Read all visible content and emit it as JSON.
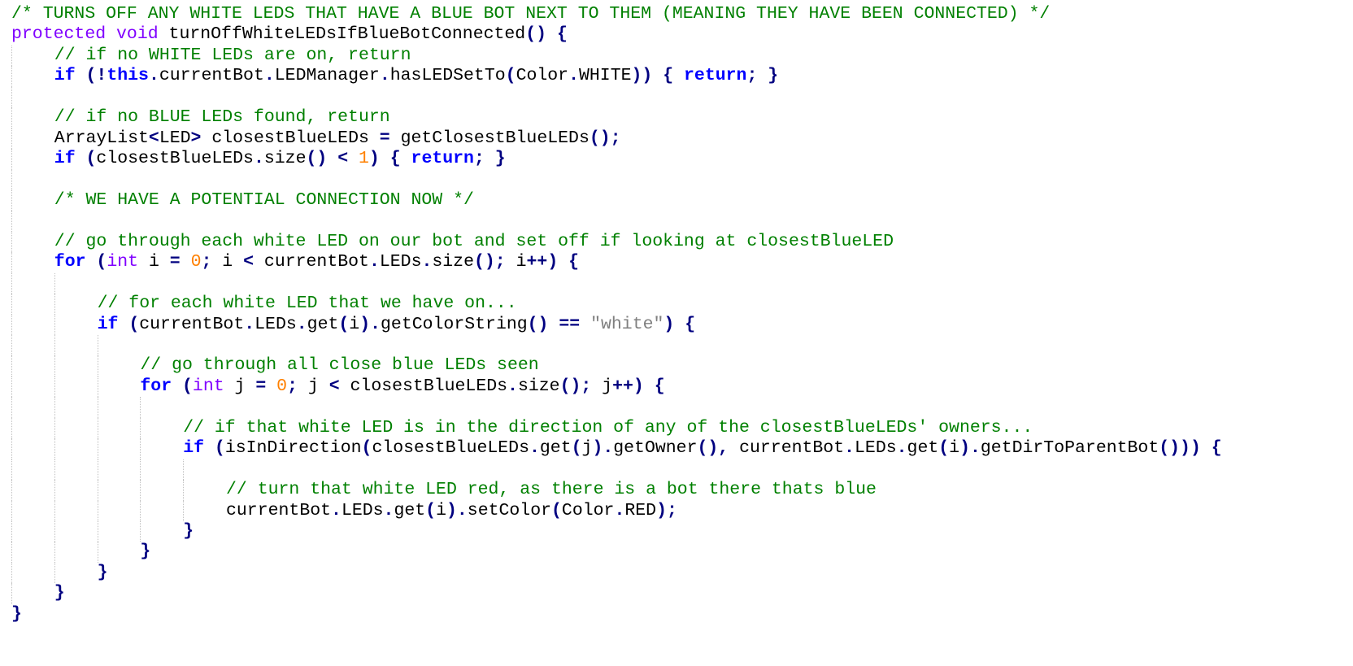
{
  "editor": {
    "colors": {
      "background": "#ffffff",
      "comment": "#008000",
      "keyword": "#0000ff",
      "type": "#8000ff",
      "number": "#ff8000",
      "string": "#808080",
      "operator": "#000080",
      "plain": "#000000",
      "indent_guide": "#c0c0c0"
    },
    "lines": [
      {
        "indent": 0,
        "tokens": [
          {
            "t": "comment",
            "v": "/* TURNS OFF ANY WHITE LEDS THAT HAVE A BLUE BOT NEXT TO THEM (MEANING THEY HAVE BEEN CONNECTED) */"
          }
        ]
      },
      {
        "indent": 0,
        "tokens": [
          {
            "t": "type",
            "v": "protected"
          },
          {
            "t": "plain",
            "v": " "
          },
          {
            "t": "type",
            "v": "void"
          },
          {
            "t": "plain",
            "v": " turnOffWhiteLEDsIfBlueBotConnected"
          },
          {
            "t": "operator",
            "v": "()"
          },
          {
            "t": "plain",
            "v": " "
          },
          {
            "t": "operator",
            "v": "{"
          }
        ]
      },
      {
        "indent": 1,
        "tokens": [
          {
            "t": "comment",
            "v": "// if no WHITE LEDs are on, return"
          }
        ]
      },
      {
        "indent": 1,
        "tokens": [
          {
            "t": "keyword",
            "v": "if"
          },
          {
            "t": "plain",
            "v": " "
          },
          {
            "t": "operator",
            "v": "(!"
          },
          {
            "t": "keyword",
            "v": "this"
          },
          {
            "t": "operator",
            "v": "."
          },
          {
            "t": "plain",
            "v": "currentBot"
          },
          {
            "t": "operator",
            "v": "."
          },
          {
            "t": "plain",
            "v": "LEDManager"
          },
          {
            "t": "operator",
            "v": "."
          },
          {
            "t": "plain",
            "v": "hasLEDSetTo"
          },
          {
            "t": "operator",
            "v": "("
          },
          {
            "t": "plain",
            "v": "Color"
          },
          {
            "t": "operator",
            "v": "."
          },
          {
            "t": "plain",
            "v": "WHITE"
          },
          {
            "t": "operator",
            "v": "))"
          },
          {
            "t": "plain",
            "v": " "
          },
          {
            "t": "operator",
            "v": "{"
          },
          {
            "t": "plain",
            "v": " "
          },
          {
            "t": "keyword",
            "v": "return"
          },
          {
            "t": "operator",
            "v": ";"
          },
          {
            "t": "plain",
            "v": " "
          },
          {
            "t": "operator",
            "v": "}"
          }
        ]
      },
      {
        "indent": 1,
        "tokens": []
      },
      {
        "indent": 1,
        "tokens": [
          {
            "t": "comment",
            "v": "// if no BLUE LEDs found, return"
          }
        ]
      },
      {
        "indent": 1,
        "tokens": [
          {
            "t": "plain",
            "v": "ArrayList"
          },
          {
            "t": "operator",
            "v": "<"
          },
          {
            "t": "plain",
            "v": "LED"
          },
          {
            "t": "operator",
            "v": ">"
          },
          {
            "t": "plain",
            "v": " closestBlueLEDs "
          },
          {
            "t": "operator",
            "v": "="
          },
          {
            "t": "plain",
            "v": " getClosestBlueLEDs"
          },
          {
            "t": "operator",
            "v": "();"
          }
        ]
      },
      {
        "indent": 1,
        "tokens": [
          {
            "t": "keyword",
            "v": "if"
          },
          {
            "t": "plain",
            "v": " "
          },
          {
            "t": "operator",
            "v": "("
          },
          {
            "t": "plain",
            "v": "closestBlueLEDs"
          },
          {
            "t": "operator",
            "v": "."
          },
          {
            "t": "plain",
            "v": "size"
          },
          {
            "t": "operator",
            "v": "()"
          },
          {
            "t": "plain",
            "v": " "
          },
          {
            "t": "operator",
            "v": "<"
          },
          {
            "t": "plain",
            "v": " "
          },
          {
            "t": "number",
            "v": "1"
          },
          {
            "t": "operator",
            "v": ")"
          },
          {
            "t": "plain",
            "v": " "
          },
          {
            "t": "operator",
            "v": "{"
          },
          {
            "t": "plain",
            "v": " "
          },
          {
            "t": "keyword",
            "v": "return"
          },
          {
            "t": "operator",
            "v": ";"
          },
          {
            "t": "plain",
            "v": " "
          },
          {
            "t": "operator",
            "v": "}"
          }
        ]
      },
      {
        "indent": 1,
        "tokens": []
      },
      {
        "indent": 1,
        "tokens": [
          {
            "t": "comment",
            "v": "/* WE HAVE A POTENTIAL CONNECTION NOW */"
          }
        ]
      },
      {
        "indent": 1,
        "tokens": []
      },
      {
        "indent": 1,
        "tokens": [
          {
            "t": "comment",
            "v": "// go through each white LED on our bot and set off if looking at closestBlueLED"
          }
        ]
      },
      {
        "indent": 1,
        "tokens": [
          {
            "t": "keyword",
            "v": "for"
          },
          {
            "t": "plain",
            "v": " "
          },
          {
            "t": "operator",
            "v": "("
          },
          {
            "t": "type",
            "v": "int"
          },
          {
            "t": "plain",
            "v": " i "
          },
          {
            "t": "operator",
            "v": "="
          },
          {
            "t": "plain",
            "v": " "
          },
          {
            "t": "number",
            "v": "0"
          },
          {
            "t": "operator",
            "v": ";"
          },
          {
            "t": "plain",
            "v": " i "
          },
          {
            "t": "operator",
            "v": "<"
          },
          {
            "t": "plain",
            "v": " currentBot"
          },
          {
            "t": "operator",
            "v": "."
          },
          {
            "t": "plain",
            "v": "LEDs"
          },
          {
            "t": "operator",
            "v": "."
          },
          {
            "t": "plain",
            "v": "size"
          },
          {
            "t": "operator",
            "v": "();"
          },
          {
            "t": "plain",
            "v": " i"
          },
          {
            "t": "operator",
            "v": "++)"
          },
          {
            "t": "plain",
            "v": " "
          },
          {
            "t": "operator",
            "v": "{"
          }
        ]
      },
      {
        "indent": 2,
        "tokens": []
      },
      {
        "indent": 2,
        "tokens": [
          {
            "t": "comment",
            "v": "// for each white LED that we have on..."
          }
        ]
      },
      {
        "indent": 2,
        "tokens": [
          {
            "t": "keyword",
            "v": "if"
          },
          {
            "t": "plain",
            "v": " "
          },
          {
            "t": "operator",
            "v": "("
          },
          {
            "t": "plain",
            "v": "currentBot"
          },
          {
            "t": "operator",
            "v": "."
          },
          {
            "t": "plain",
            "v": "LEDs"
          },
          {
            "t": "operator",
            "v": "."
          },
          {
            "t": "plain",
            "v": "get"
          },
          {
            "t": "operator",
            "v": "("
          },
          {
            "t": "plain",
            "v": "i"
          },
          {
            "t": "operator",
            "v": ")."
          },
          {
            "t": "plain",
            "v": "getColorString"
          },
          {
            "t": "operator",
            "v": "()"
          },
          {
            "t": "plain",
            "v": " "
          },
          {
            "t": "operator",
            "v": "=="
          },
          {
            "t": "plain",
            "v": " "
          },
          {
            "t": "string",
            "v": "\"white\""
          },
          {
            "t": "operator",
            "v": ")"
          },
          {
            "t": "plain",
            "v": " "
          },
          {
            "t": "operator",
            "v": "{"
          }
        ]
      },
      {
        "indent": 3,
        "tokens": []
      },
      {
        "indent": 3,
        "tokens": [
          {
            "t": "comment",
            "v": "// go through all close blue LEDs seen"
          }
        ]
      },
      {
        "indent": 3,
        "tokens": [
          {
            "t": "keyword",
            "v": "for"
          },
          {
            "t": "plain",
            "v": " "
          },
          {
            "t": "operator",
            "v": "("
          },
          {
            "t": "type",
            "v": "int"
          },
          {
            "t": "plain",
            "v": " j "
          },
          {
            "t": "operator",
            "v": "="
          },
          {
            "t": "plain",
            "v": " "
          },
          {
            "t": "number",
            "v": "0"
          },
          {
            "t": "operator",
            "v": ";"
          },
          {
            "t": "plain",
            "v": " j "
          },
          {
            "t": "operator",
            "v": "<"
          },
          {
            "t": "plain",
            "v": " closestBlueLEDs"
          },
          {
            "t": "operator",
            "v": "."
          },
          {
            "t": "plain",
            "v": "size"
          },
          {
            "t": "operator",
            "v": "();"
          },
          {
            "t": "plain",
            "v": " j"
          },
          {
            "t": "operator",
            "v": "++)"
          },
          {
            "t": "plain",
            "v": " "
          },
          {
            "t": "operator",
            "v": "{"
          }
        ]
      },
      {
        "indent": 4,
        "tokens": []
      },
      {
        "indent": 4,
        "tokens": [
          {
            "t": "comment",
            "v": "// if that white LED is in the direction of any of the closestBlueLEDs' owners..."
          }
        ]
      },
      {
        "indent": 4,
        "tokens": [
          {
            "t": "keyword",
            "v": "if"
          },
          {
            "t": "plain",
            "v": " "
          },
          {
            "t": "operator",
            "v": "("
          },
          {
            "t": "plain",
            "v": "isInDirection"
          },
          {
            "t": "operator",
            "v": "("
          },
          {
            "t": "plain",
            "v": "closestBlueLEDs"
          },
          {
            "t": "operator",
            "v": "."
          },
          {
            "t": "plain",
            "v": "get"
          },
          {
            "t": "operator",
            "v": "("
          },
          {
            "t": "plain",
            "v": "j"
          },
          {
            "t": "operator",
            "v": ")."
          },
          {
            "t": "plain",
            "v": "getOwner"
          },
          {
            "t": "operator",
            "v": "(),"
          },
          {
            "t": "plain",
            "v": " currentBot"
          },
          {
            "t": "operator",
            "v": "."
          },
          {
            "t": "plain",
            "v": "LEDs"
          },
          {
            "t": "operator",
            "v": "."
          },
          {
            "t": "plain",
            "v": "get"
          },
          {
            "t": "operator",
            "v": "("
          },
          {
            "t": "plain",
            "v": "i"
          },
          {
            "t": "operator",
            "v": ")."
          },
          {
            "t": "plain",
            "v": "getDirToParentBot"
          },
          {
            "t": "operator",
            "v": "()))"
          },
          {
            "t": "plain",
            "v": " "
          },
          {
            "t": "operator",
            "v": "{"
          }
        ]
      },
      {
        "indent": 5,
        "tokens": []
      },
      {
        "indent": 5,
        "tokens": [
          {
            "t": "comment",
            "v": "// turn that white LED red, as there is a bot there thats blue"
          }
        ]
      },
      {
        "indent": 5,
        "tokens": [
          {
            "t": "plain",
            "v": "currentBot"
          },
          {
            "t": "operator",
            "v": "."
          },
          {
            "t": "plain",
            "v": "LEDs"
          },
          {
            "t": "operator",
            "v": "."
          },
          {
            "t": "plain",
            "v": "get"
          },
          {
            "t": "operator",
            "v": "("
          },
          {
            "t": "plain",
            "v": "i"
          },
          {
            "t": "operator",
            "v": ")."
          },
          {
            "t": "plain",
            "v": "setColor"
          },
          {
            "t": "operator",
            "v": "("
          },
          {
            "t": "plain",
            "v": "Color"
          },
          {
            "t": "operator",
            "v": "."
          },
          {
            "t": "plain",
            "v": "RED"
          },
          {
            "t": "operator",
            "v": ");"
          }
        ]
      },
      {
        "indent": 4,
        "tokens": [
          {
            "t": "operator",
            "v": "}"
          }
        ]
      },
      {
        "indent": 3,
        "tokens": [
          {
            "t": "operator",
            "v": "}"
          }
        ]
      },
      {
        "indent": 2,
        "tokens": [
          {
            "t": "operator",
            "v": "}"
          }
        ]
      },
      {
        "indent": 1,
        "tokens": [
          {
            "t": "operator",
            "v": "}"
          }
        ]
      },
      {
        "indent": 0,
        "tokens": [
          {
            "t": "operator",
            "v": "}"
          }
        ]
      }
    ]
  }
}
